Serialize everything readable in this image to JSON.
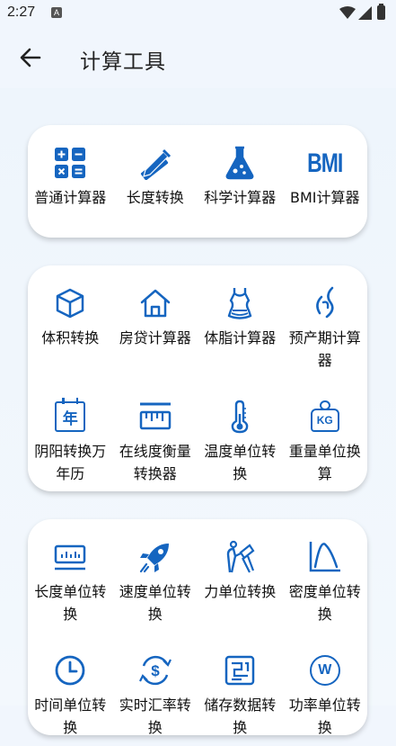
{
  "status": {
    "time": "2:27",
    "notif": "A"
  },
  "header": {
    "title": "计算工具"
  },
  "colors": {
    "accent": "#1565c0",
    "background": "#f1f6fd",
    "card": "#ffffff"
  },
  "groups": [
    {
      "items": [
        {
          "label": "普通计算器",
          "icon": "calculator-icon"
        },
        {
          "label": "长度转换",
          "icon": "ruler-pencil-icon"
        },
        {
          "label": "科学计算器",
          "icon": "flask-icon"
        },
        {
          "label": "BMI计算器",
          "icon": "bmi-icon",
          "icon_text": "BMI"
        }
      ]
    },
    {
      "items": [
        {
          "label": "体积转换",
          "icon": "cube-icon"
        },
        {
          "label": "房贷计算器",
          "icon": "house-icon"
        },
        {
          "label": "体脂计算器",
          "icon": "body-fat-icon"
        },
        {
          "label": "预产期计算器",
          "icon": "pregnancy-icon"
        },
        {
          "label": "阴阳转换万年历",
          "icon": "calendar-icon",
          "icon_text": "年"
        },
        {
          "label": "在线度衡量转换器",
          "icon": "scale-ruler-icon"
        },
        {
          "label": "温度单位转换",
          "icon": "thermometer-icon"
        },
        {
          "label": "重量单位换算",
          "icon": "weight-icon",
          "icon_text": "KG"
        }
      ]
    },
    {
      "items": [
        {
          "label": "长度单位转换",
          "icon": "length-meter-icon"
        },
        {
          "label": "速度单位转换",
          "icon": "rocket-icon"
        },
        {
          "label": "力单位转换",
          "icon": "force-icon"
        },
        {
          "label": "密度单位转换",
          "icon": "density-curve-icon"
        },
        {
          "label": "时间单位转换",
          "icon": "clock-icon"
        },
        {
          "label": "实时汇率转换",
          "icon": "currency-exchange-icon"
        },
        {
          "label": "储存数据转换",
          "icon": "storage-icon"
        },
        {
          "label": "功率单位转换",
          "icon": "power-w-icon",
          "icon_text": "W"
        }
      ]
    }
  ]
}
